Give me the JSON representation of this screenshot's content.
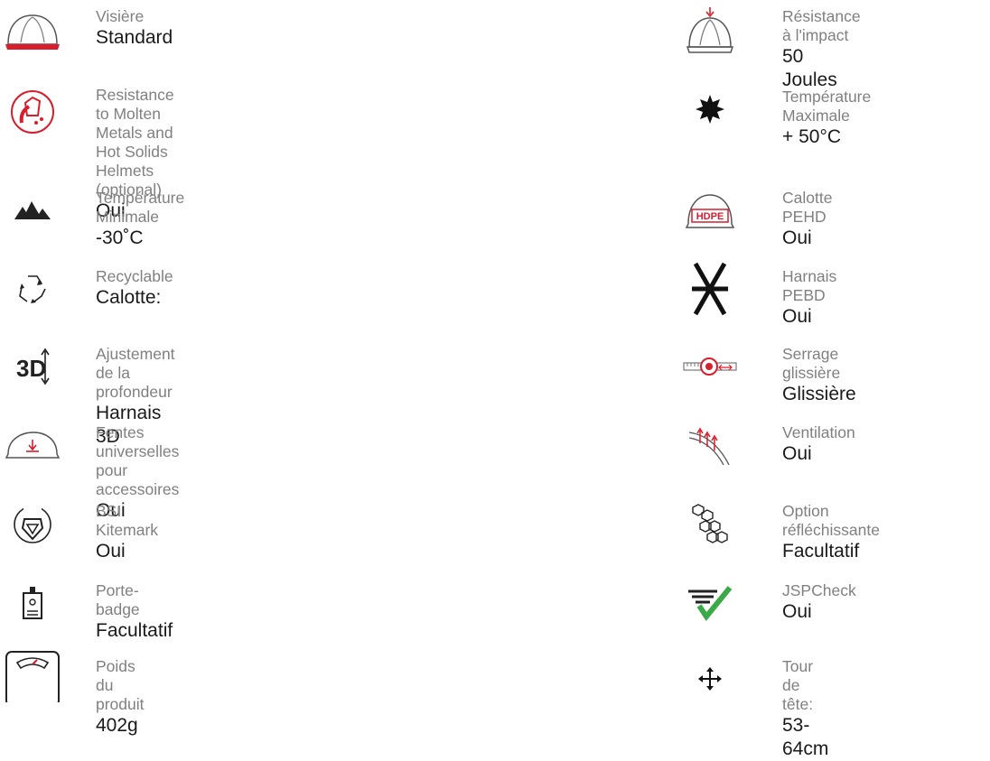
{
  "left_features": [
    {
      "label": "Visière",
      "value": "Standard",
      "icon": "helmet-visor-icon"
    },
    {
      "label": "Resistance to Molten Metals and Hot Solids Helmets (optional)",
      "value": "Oui",
      "icon": "molten-metal-icon"
    },
    {
      "label": "Température Minimale",
      "value": "-30˚C",
      "icon": "mountains-icon"
    },
    {
      "label": "Recyclable",
      "value": "Calotte:",
      "icon": "recycle-icon"
    },
    {
      "label": "Ajustement de la profondeur",
      "value": "Harnais 3D",
      "icon": "3d-depth-icon"
    },
    {
      "label": "Fentes universelles pour accessoires",
      "value": "Oui",
      "icon": "accessory-slot-icon"
    },
    {
      "label": "BSI Kitemark",
      "value": "Oui",
      "icon": "bsi-kitemark-icon"
    },
    {
      "label": "Porte-badge",
      "value": "Facultatif",
      "icon": "badge-holder-icon"
    },
    {
      "label": "Poids du produit",
      "value": "402g",
      "icon": "weight-scale-icon"
    }
  ],
  "right_features": [
    {
      "label": "Résistance à l'impact",
      "value": "50 Joules",
      "icon": "impact-helmet-icon"
    },
    {
      "label": "Température Maximale",
      "value": "+ 50°C",
      "icon": "sun-icon"
    },
    {
      "label": "Calotte PEHD",
      "value": "Oui",
      "icon": "hdpe-shell-icon",
      "icon_text": "HDPE"
    },
    {
      "label": "Harnais PEBD",
      "value": "Oui",
      "icon": "ldpe-harness-icon"
    },
    {
      "label": "Serrage glissière",
      "value": "Glissière",
      "icon": "slide-adjust-icon"
    },
    {
      "label": "Ventilation",
      "value": "Oui",
      "icon": "ventilation-icon"
    },
    {
      "label": "Option réfléchissante",
      "value": "Facultatif",
      "icon": "reflective-option-icon"
    },
    {
      "label": "JSPCheck",
      "value": "Oui",
      "icon": "jspcheck-icon"
    },
    {
      "label": "Tour de tête:",
      "value": "53-64cm",
      "icon": "head-size-icon"
    }
  ],
  "colors": {
    "accent_red": "#d81e2c",
    "check_green": "#3aaa48",
    "label_gray": "#808080",
    "value_dark": "#1a1a1a"
  }
}
